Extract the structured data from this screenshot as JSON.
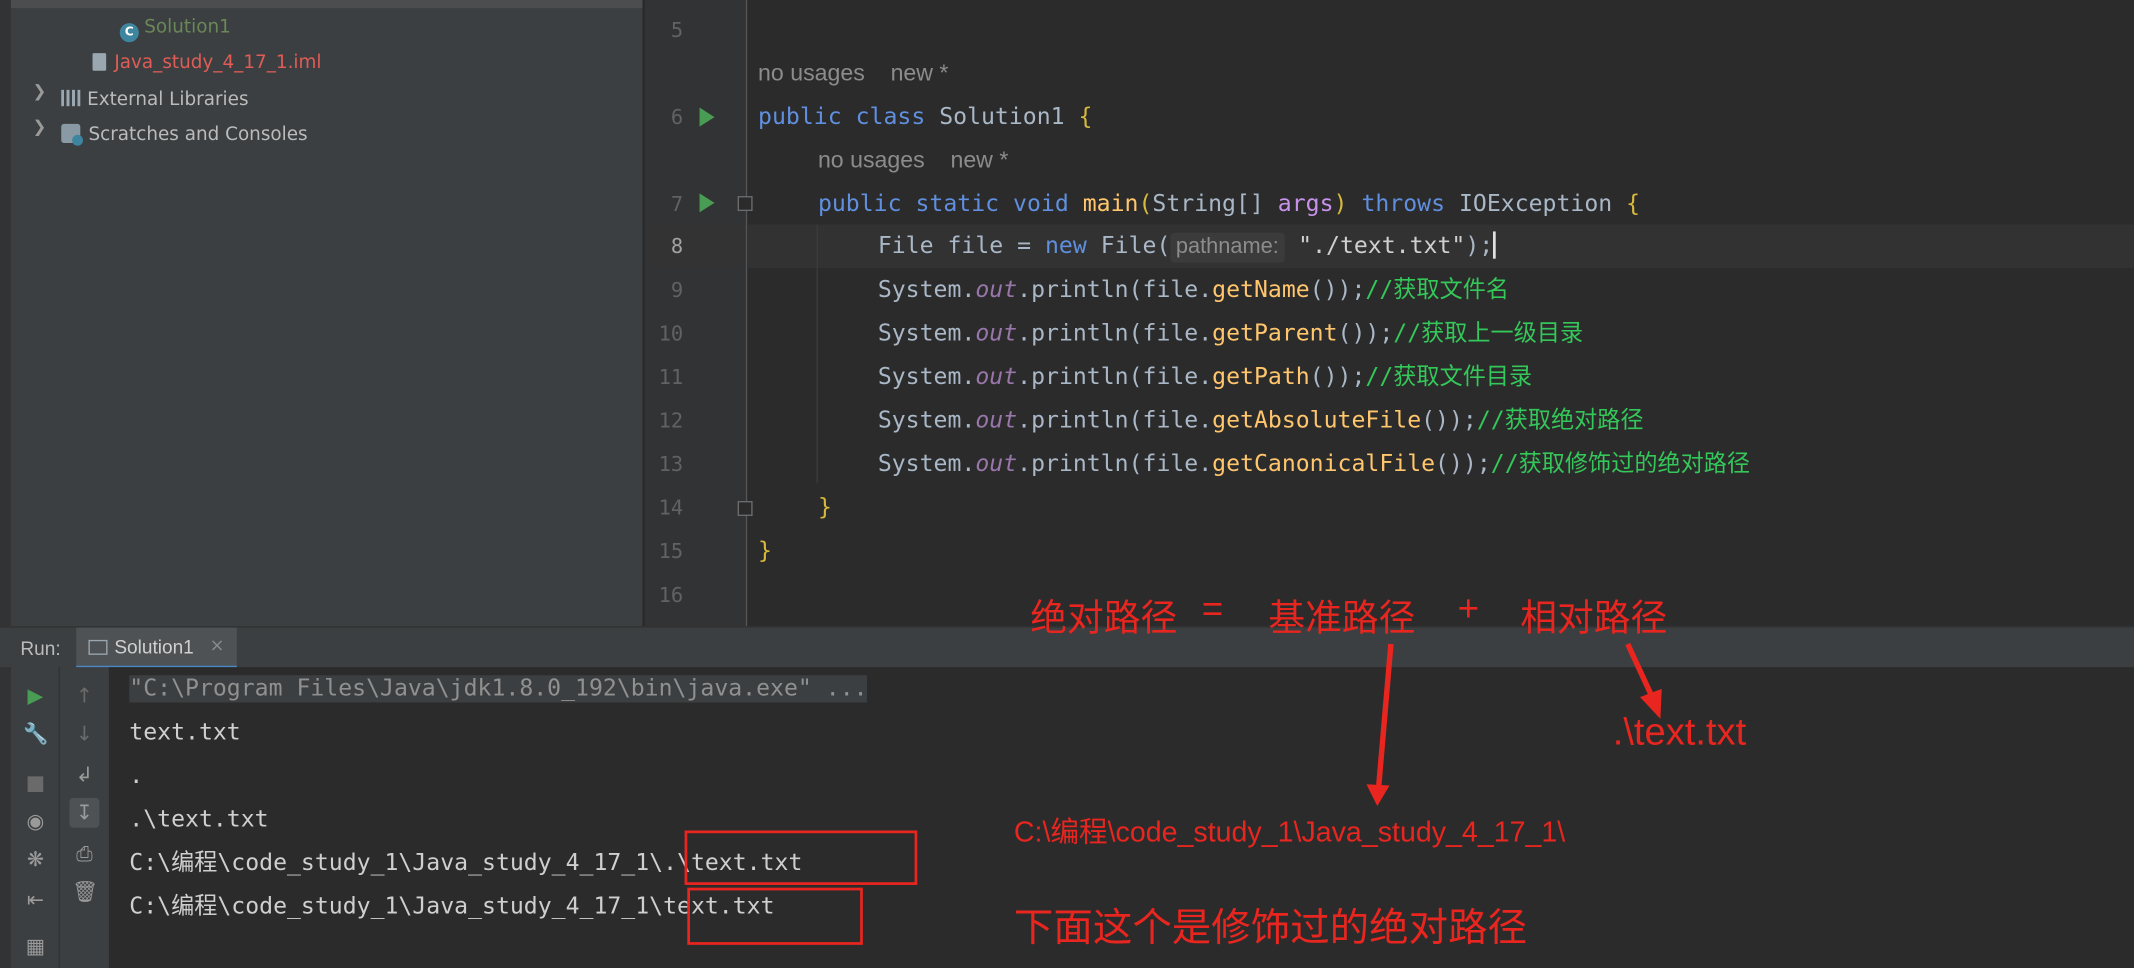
{
  "colors": {
    "comment": "#34c759",
    "keyword": "#cc7832",
    "annotation": "#e8261f"
  },
  "project_tree": {
    "items": [
      {
        "label": "Solution1",
        "icon": "java-class-icon",
        "color": "#6a8759"
      },
      {
        "label": "Java_study_4_17_1.iml",
        "icon": "module-file-icon",
        "color": "#e05c56"
      },
      {
        "label": "External Libraries",
        "icon": "libraries-icon",
        "color": "#bbbbbb"
      },
      {
        "label": "Scratches and Consoles",
        "icon": "scratches-icon",
        "color": "#bbbbbb"
      }
    ]
  },
  "editor": {
    "line_numbers": [
      "5",
      "6",
      "7",
      "8",
      "9",
      "10",
      "11",
      "12",
      "13",
      "14",
      "15",
      "16"
    ],
    "hints": {
      "usage1": "no usages",
      "new1": "new *",
      "usage2": "no usages",
      "new2": "new *",
      "pathname": "pathname:"
    },
    "code": {
      "l6_kw1": "public",
      "l6_kw2": "class",
      "l6_name": "Solution1",
      "l6_brace": "{",
      "l7_kw1": "public",
      "l7_kw2": "static",
      "l7_kw3": "void",
      "l7_name": "main",
      "l7_p1": "(",
      "l7_type": "String[]",
      "l7_arg": "args",
      "l7_p2": ")",
      "l7_throws": "throws",
      "l7_exc": "IOException",
      "l7_brace": "{",
      "l8_a": "File file = ",
      "l8_new": "new",
      "l8_b": "File(",
      "l8_str": "\"./text.txt\"",
      "l8_c": ");",
      "sys": "System.",
      "out": "out",
      "println": ".println(file.",
      "l9_m": "getName",
      "l9_end": "());",
      "l9_cmt": "//获取文件名",
      "l10_m": "getParent",
      "l10_end": "());",
      "l10_cmt": "//获取上一级目录",
      "l11_m": "getPath",
      "l11_end": "());",
      "l11_cmt": "//获取文件目录",
      "l12_m": "getAbsoluteFile",
      "l12_end": "());",
      "l12_cmt": "//获取绝对路径",
      "l13_m": "getCanonicalFile",
      "l13_end": "());",
      "l13_cmt": "//获取修饰过的绝对路径",
      "l14": "}",
      "l15": "}"
    }
  },
  "run_panel": {
    "label": "Run:",
    "tab": "Solution1",
    "tab_close": "×",
    "console_lines": [
      "\"C:\\Program Files\\Java\\jdk1.8.0_192\\bin\\java.exe\" ...",
      "text.txt",
      ".",
      ".\\text.txt",
      "C:\\编程\\code_study_1\\Java_study_4_17_1\\.\\text.txt",
      "C:\\编程\\code_study_1\\Java_study_4_17_1\\text.txt"
    ]
  },
  "annotations": {
    "formula_abs": "绝对路径",
    "formula_eq": "=",
    "formula_base": "基准路径",
    "formula_plus": "+",
    "formula_rel": "相对路径",
    "relative_value": ".\\text.txt",
    "base_value": "C:\\编程\\code_study_1\\Java_study_4_17_1\\",
    "canonical_note": "下面这个是修饰过的绝对路径"
  }
}
